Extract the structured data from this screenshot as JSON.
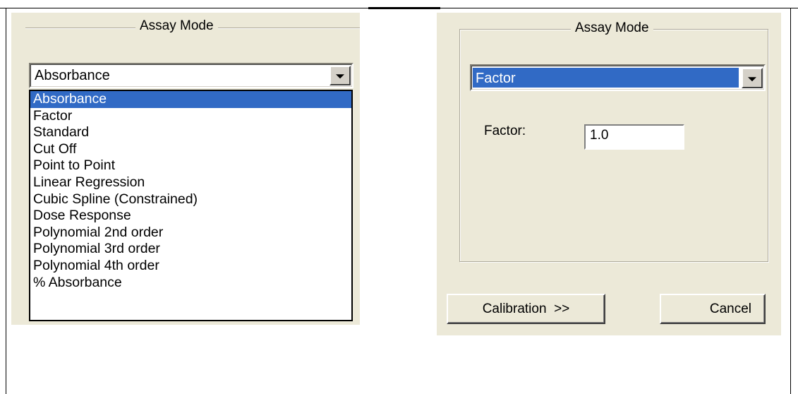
{
  "left_dialog": {
    "group_title": "Assay Mode",
    "combo_value": "Absorbance",
    "options": [
      "Absorbance",
      "Factor",
      "Standard",
      "Cut Off",
      "Point to Point",
      "Linear Regression",
      "Cubic Spline (Constrained)",
      "Dose Response",
      "Polynomial 2nd order",
      "Polynomial 3rd order",
      "Polynomial 4th order",
      "% Absorbance"
    ],
    "selected_option": "Absorbance"
  },
  "right_dialog": {
    "group_title": "Assay Mode",
    "combo_value": "Factor",
    "factor_label": "Factor:",
    "factor_value": "1.0",
    "calibration_label": "Calibration  >>",
    "cancel_label": "Cancel"
  },
  "colors": {
    "dialog_bg": "#ece9d8",
    "selection": "#316ac5"
  },
  "icons": [
    "dropdown-arrow-icon"
  ]
}
